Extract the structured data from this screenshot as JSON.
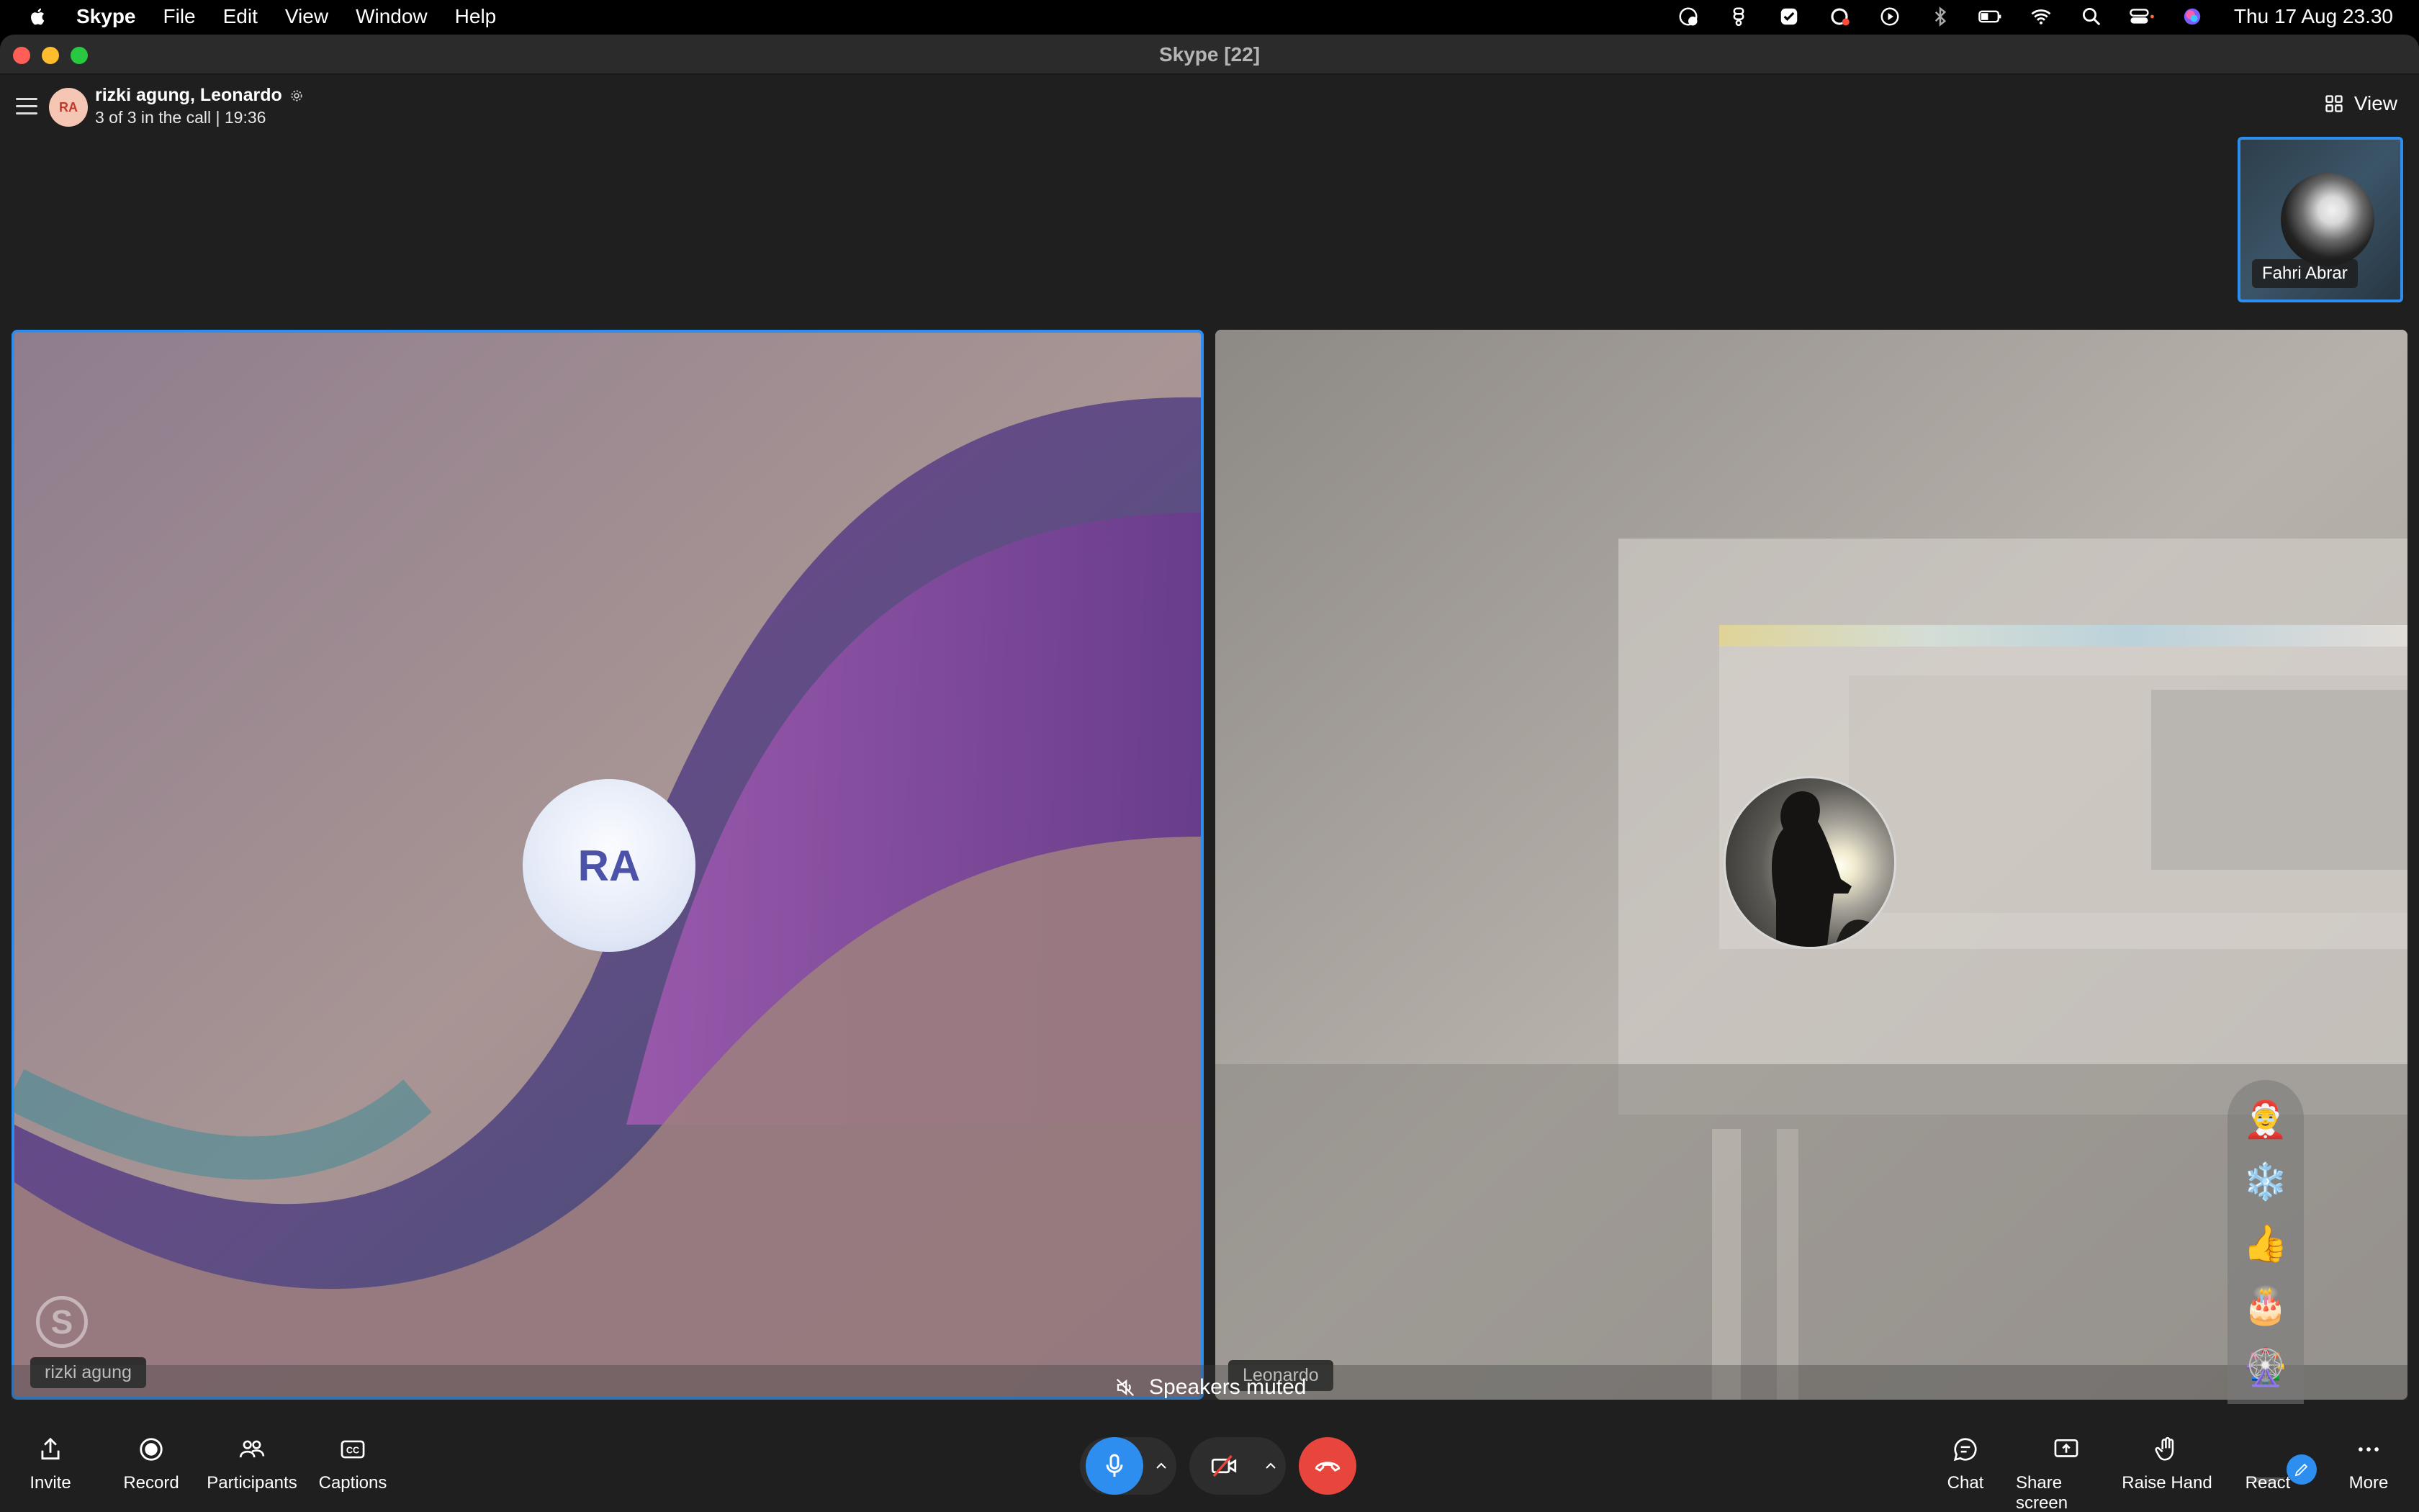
{
  "menubar": {
    "app": "Skype",
    "items": [
      "File",
      "Edit",
      "View",
      "Window",
      "Help"
    ],
    "clock": "Thu 17 Aug  23.30"
  },
  "window": {
    "title": "Skype [22]"
  },
  "header": {
    "avatar_initials": "RA",
    "call_name": "rizki agung, Leonardo",
    "status": "3 of 3 in the call | 19:36",
    "view_label": "View"
  },
  "self_preview": {
    "name": "Fahri Abrar"
  },
  "participants": [
    {
      "name": "rizki agung",
      "initials": "RA"
    },
    {
      "name": "Leonardo"
    }
  ],
  "speakers_status": "Speakers muted",
  "reactions": [
    "🤶",
    "❄️",
    "👍",
    "🎂",
    "🎡",
    "🎠"
  ],
  "toolbar": {
    "left": [
      "Invite",
      "Record",
      "Participants",
      "Captions"
    ],
    "right": [
      "Chat",
      "Share screen",
      "Raise Hand",
      "React",
      "More"
    ]
  },
  "colors": {
    "accent": "#2e8ef0",
    "end_call": "#e8453c",
    "mic_active": "#2e8ef0"
  }
}
